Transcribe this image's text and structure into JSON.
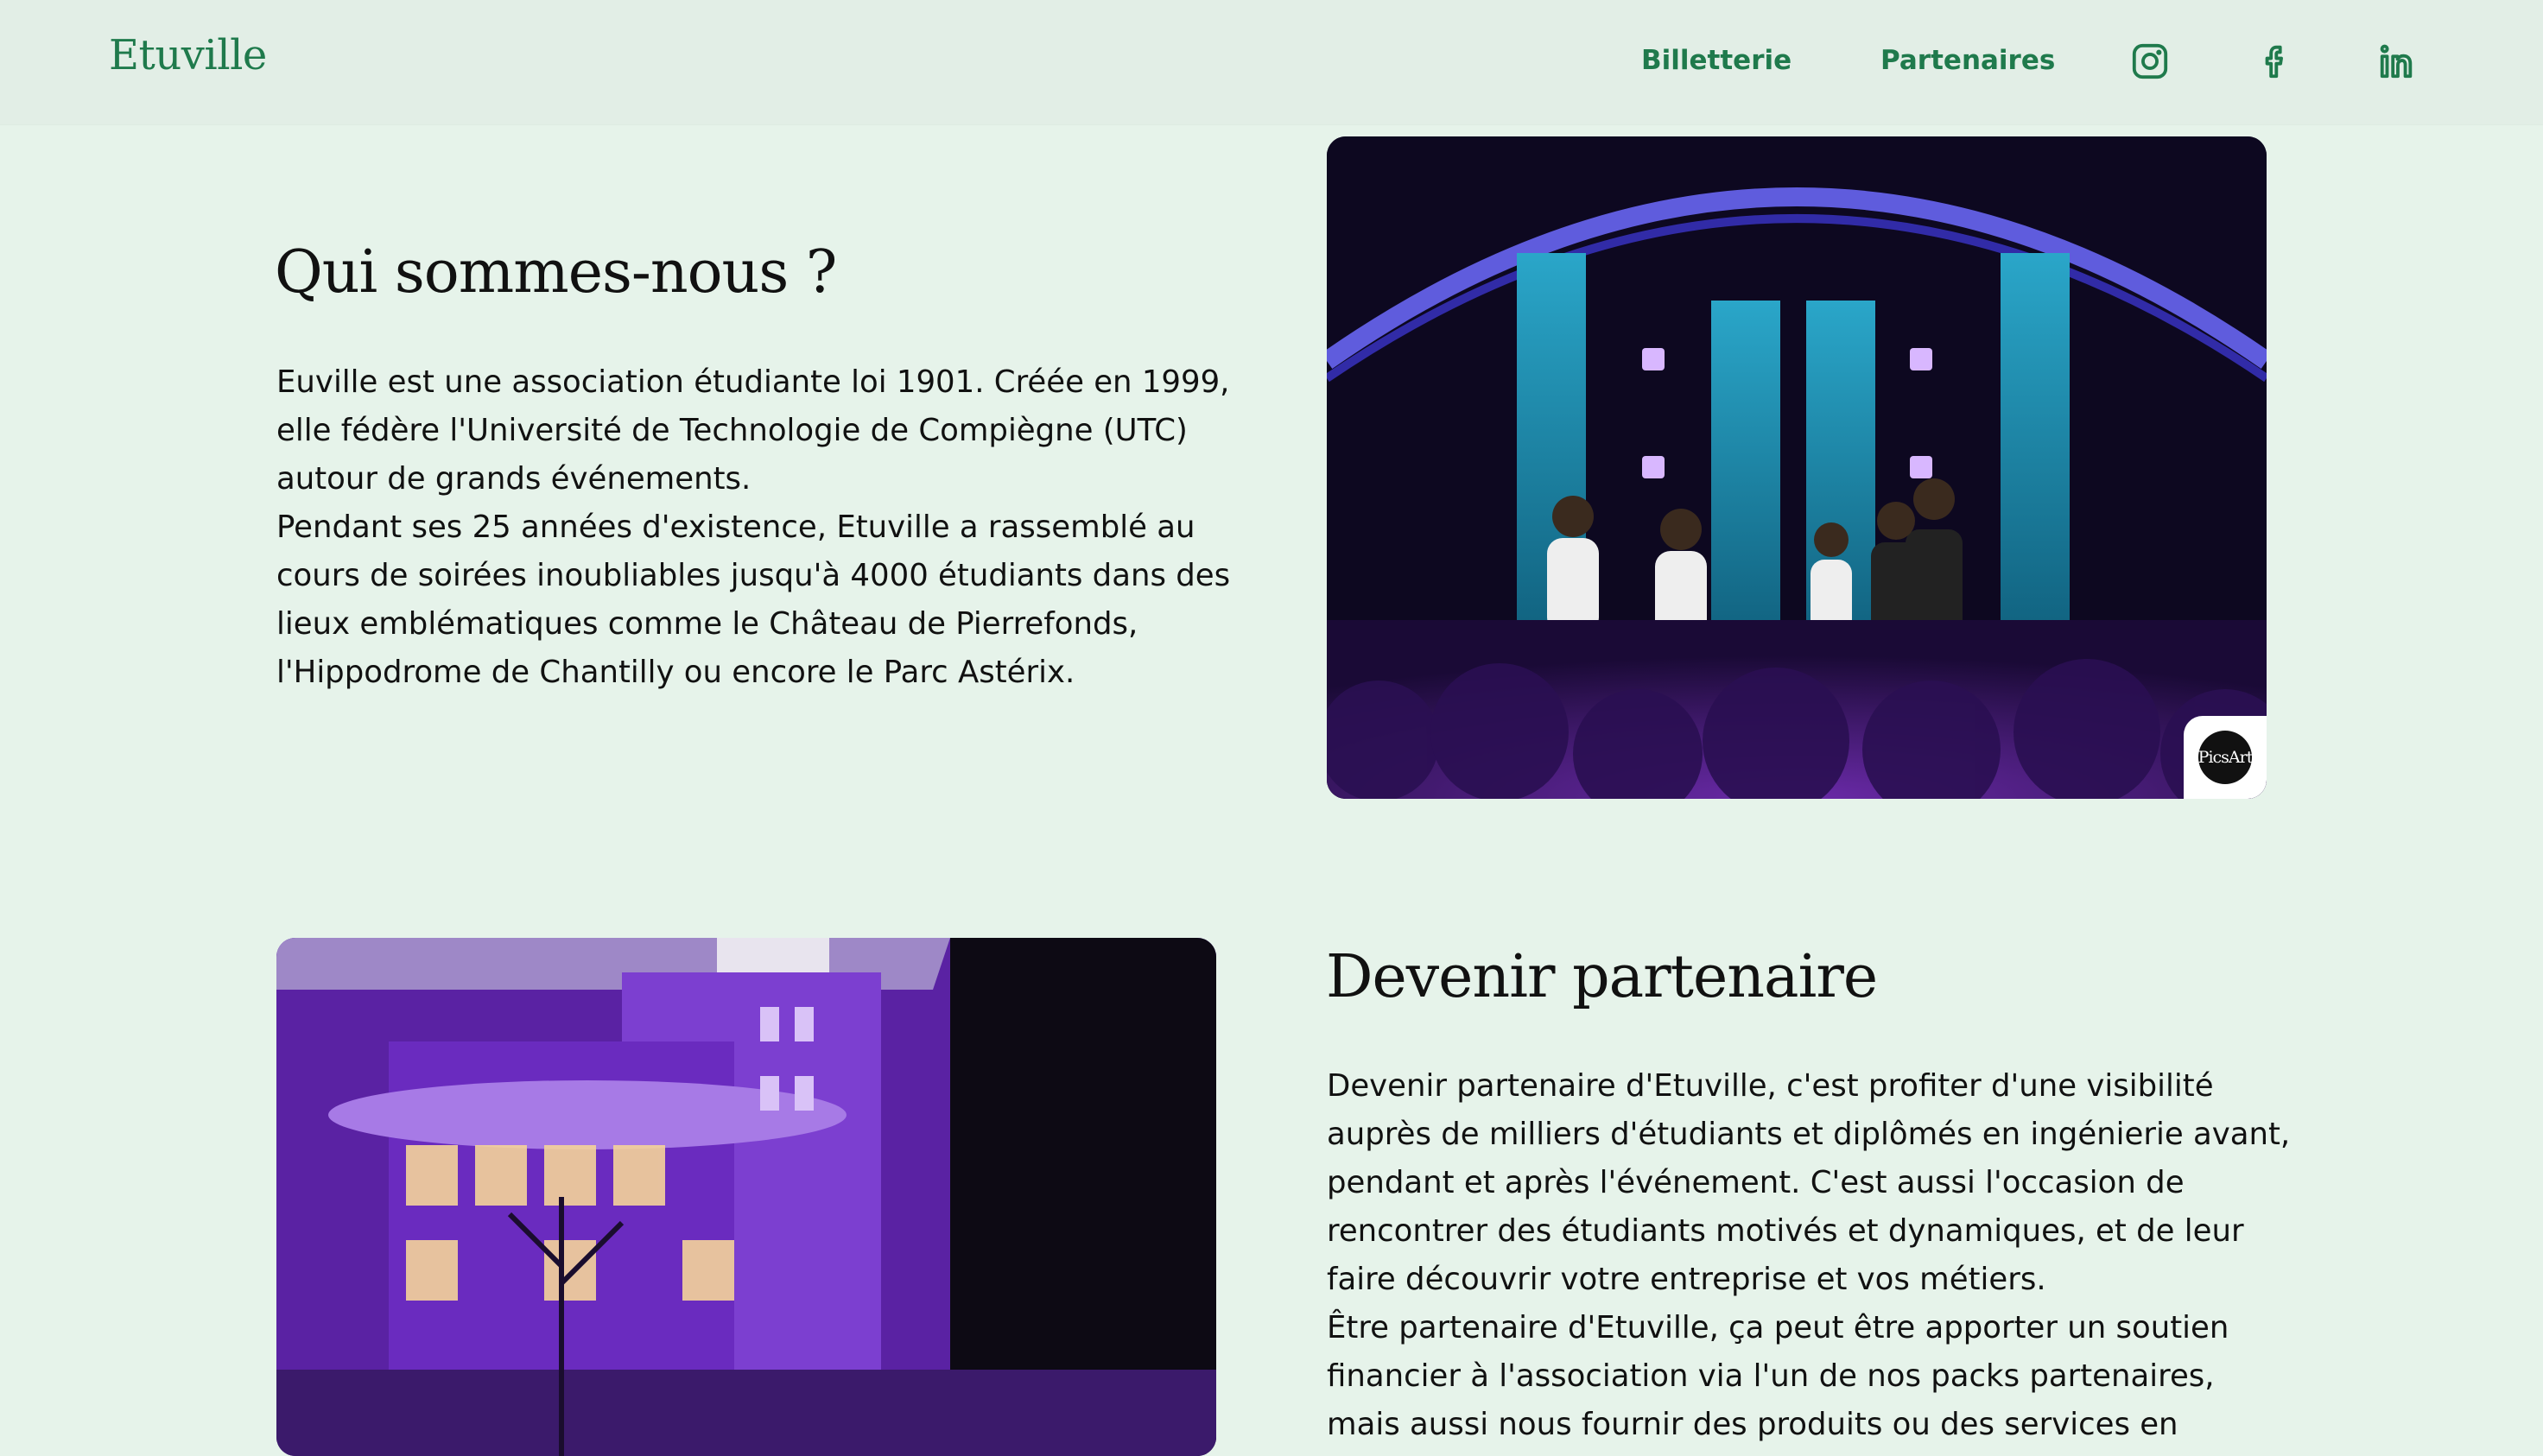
{
  "header": {
    "logo": "Etuville",
    "nav": [
      {
        "label": "Billetterie"
      },
      {
        "label": "Partenaires"
      }
    ],
    "social": [
      {
        "icon": "instagram-icon"
      },
      {
        "icon": "facebook-icon"
      },
      {
        "icon": "linkedin-icon"
      }
    ],
    "accent_color": "#1f7a4c"
  },
  "about": {
    "title": "Qui sommes-nous ?",
    "paragraphs": [
      "Euville est une association étudiante loi 1901. Créée en 1999, elle fédère l'Université de Technologie de Compiègne (UTC) autour de grands événements.",
      "Pendant ses 25 années d'existence, Etuville a rassemblé au cours de soirées inoubliables jusqu'à 4000 étudiants dans des lieux emblématiques comme le Château de Pierrefonds, l'Hippodrome de Chantilly ou encore le Parc Astérix."
    ],
    "image_watermark": "PicsArt"
  },
  "partner": {
    "title": "Devenir partenaire",
    "paragraphs": [
      "Devenir partenaire d'Etuville, c'est profiter d'une visibilité auprès de milliers d'étudiants et diplômés en ingénierie avant, pendant et après l'événement. C'est aussi l'occasion de rencontrer des étudiants motivés et dynamiques, et de leur faire découvrir votre entreprise et vos métiers.",
      "Être partenaire d'Etuville, ça peut être apporter un soutien financier à l'association via l'un de nos packs partenaires, mais aussi nous fournir des produits ou des services en"
    ]
  },
  "colors": {
    "background": "#e6f3ea",
    "header_background": "#e2eee6",
    "text": "#111111"
  }
}
